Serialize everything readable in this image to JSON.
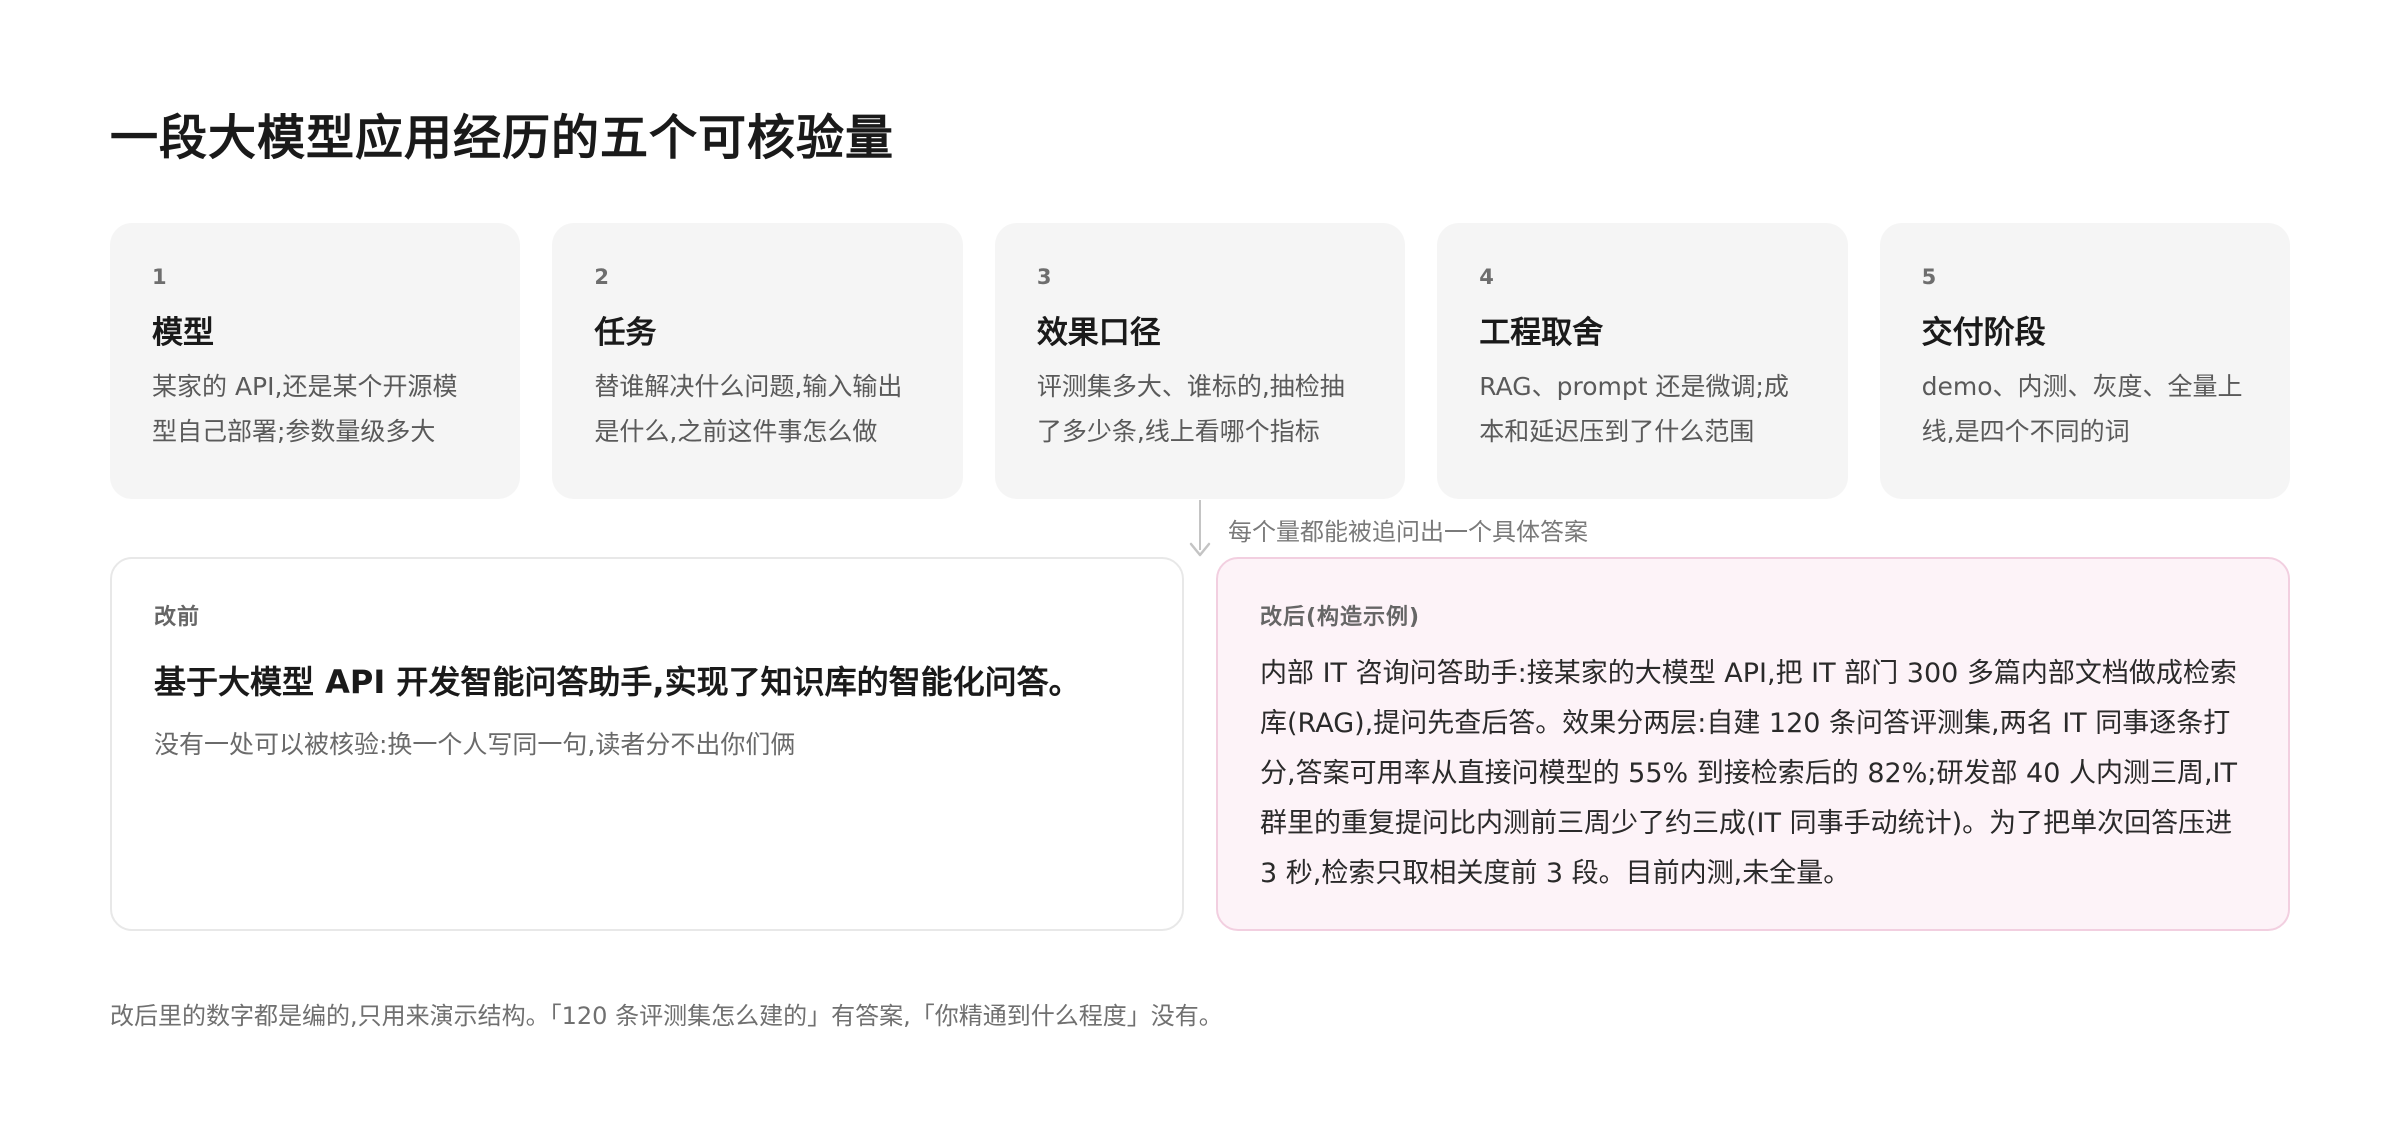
{
  "title": "一段大模型应用经历的五个可核验量",
  "cards": [
    {
      "num": "1",
      "title": "模型",
      "desc": "某家的 API,还是某个开源模型自己部署;参数量级多大"
    },
    {
      "num": "2",
      "title": "任务",
      "desc": "替谁解决什么问题,输入输出是什么,之前这件事怎么做"
    },
    {
      "num": "3",
      "title": "效果口径",
      "desc": "评测集多大、谁标的,抽检抽了多少条,线上看哪个指标"
    },
    {
      "num": "4",
      "title": "工程取舍",
      "desc": "RAG、prompt 还是微调;成本和延迟压到了什么范围"
    },
    {
      "num": "5",
      "title": "交付阶段",
      "desc": "demo、内测、灰度、全量上线,是四个不同的词"
    }
  ],
  "arrow_label": "每个量都能被追问出一个具体答案",
  "before": {
    "label": "改前",
    "headline": "基于大模型 API 开发智能问答助手,实现了知识库的智能化问答。",
    "note": "没有一处可以被核验:换一个人写同一句,读者分不出你们俩"
  },
  "after": {
    "label": "改后(构造示例)",
    "body": "内部 IT 咨询问答助手:接某家的大模型 API,把 IT 部门 300 多篇内部文档做成检索库(RAG),提问先查后答。效果分两层:自建 120 条问答评测集,两名 IT 同事逐条打分,答案可用率从直接问模型的 55% 到接检索后的 82%;研发部 40 人内测三周,IT 群里的重复提问比内测前三周少了约三成(IT 同事手动统计)。为了把单次回答压进 3 秒,检索只取相关度前 3 段。目前内测,未全量。"
  },
  "footnote": "改后里的数字都是编的,只用来演示结构。「120 条评测集怎么建的」有答案,「你精通到什么程度」没有。",
  "colors": {
    "card_bg": "#f5f5f5",
    "after_bg": "#fdf3f8",
    "after_border": "#f2cfe0"
  }
}
